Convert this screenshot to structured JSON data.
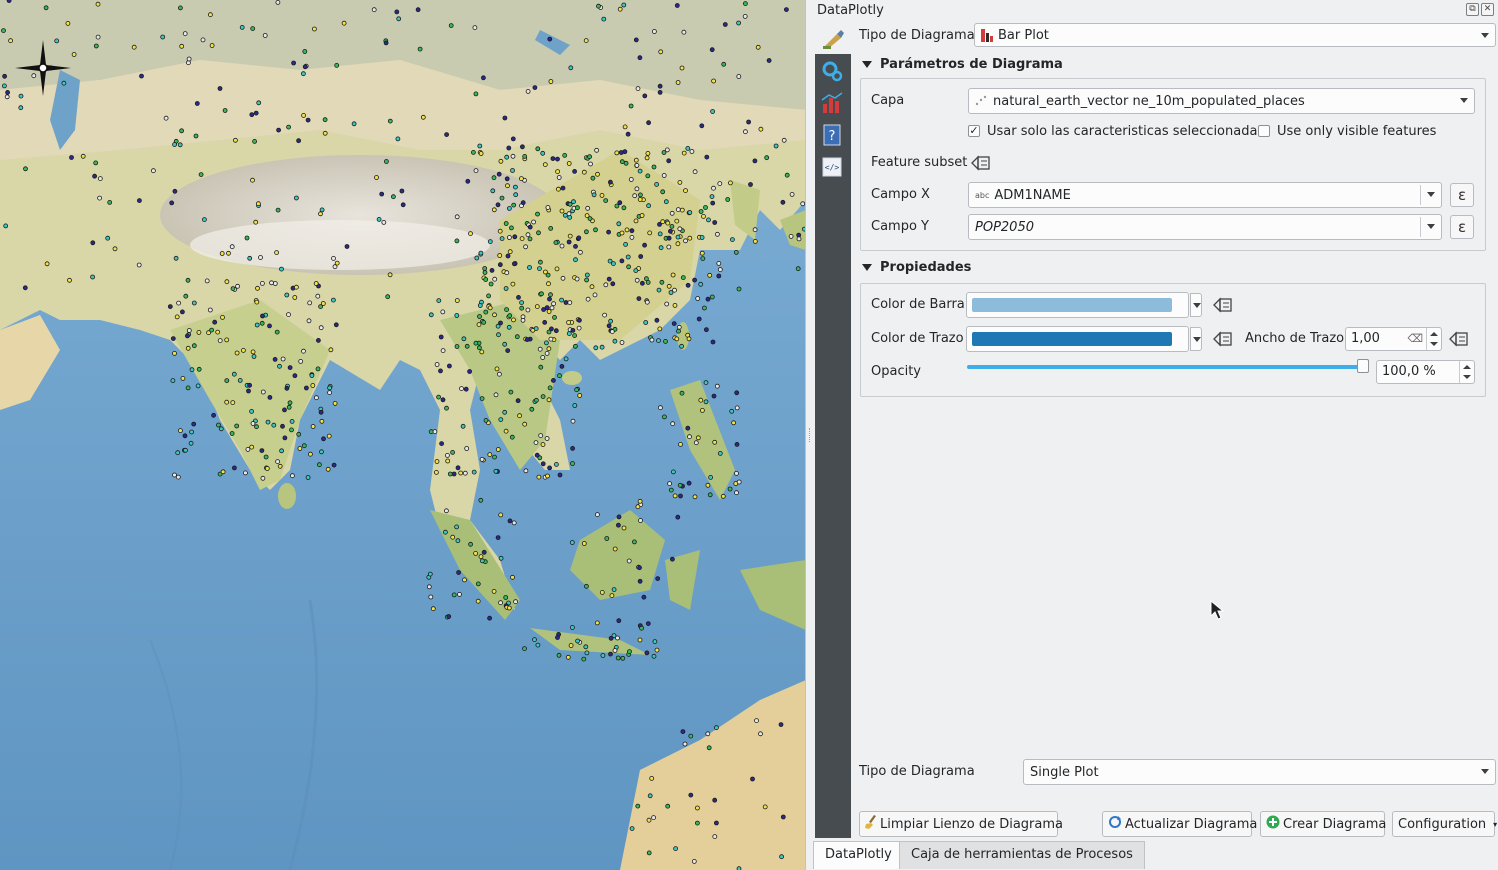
{
  "dock": {
    "title": "DataPlotly",
    "plot_type_label": "Tipo de Diagrama",
    "plot_type_value": "Bar Plot",
    "plot_params": {
      "header": "Parámetros de Diagrama",
      "layer_label": "Capa",
      "layer_value": "natural_earth_vector ne_10m_populated_places",
      "selected_only_label": "Usar solo las caracteristicas seleccionadas.",
      "selected_only_checked": true,
      "visible_only_label": "Use only visible features",
      "visible_only_checked": false,
      "feature_subset_label": "Feature subset",
      "x_label": "Campo X",
      "x_value": "ADM1NAME",
      "x_type_badge": "abc",
      "y_label": "Campo Y",
      "y_value": "POP2050",
      "epsilon": "ε"
    },
    "properties": {
      "header": "Propiedades",
      "bar_color_label": "Color de Barra",
      "bar_color": "#8cbbdb",
      "stroke_color_label": "Color de Trazo",
      "stroke_color": "#1f77b4",
      "stroke_width_label": "Ancho de Trazo",
      "stroke_width_value": "1,00",
      "opacity_label": "Opacity",
      "opacity_value": "100,0 %",
      "opacity_fraction": 1.0
    },
    "plot_mode_label": "Tipo de Diagrama",
    "plot_mode_value": "Single Plot",
    "buttons": {
      "clear": "Limpiar Lienzo de Diagrama",
      "update": "Actualizar Diagrama",
      "create": "Crear Diagrama",
      "config": "Configuration"
    },
    "tabs": [
      "DataPlotly",
      "Caja de herramientas de Procesos"
    ]
  },
  "colors": {
    "accent": "#3daee9",
    "sidebar": "#474c50"
  },
  "icons": [
    "brush-icon",
    "settings-icon",
    "plot-icon",
    "help-icon",
    "code-icon",
    "data-defined-icon",
    "bar-plot-icon",
    "point-layer-icon",
    "north-arrow-icon"
  ]
}
